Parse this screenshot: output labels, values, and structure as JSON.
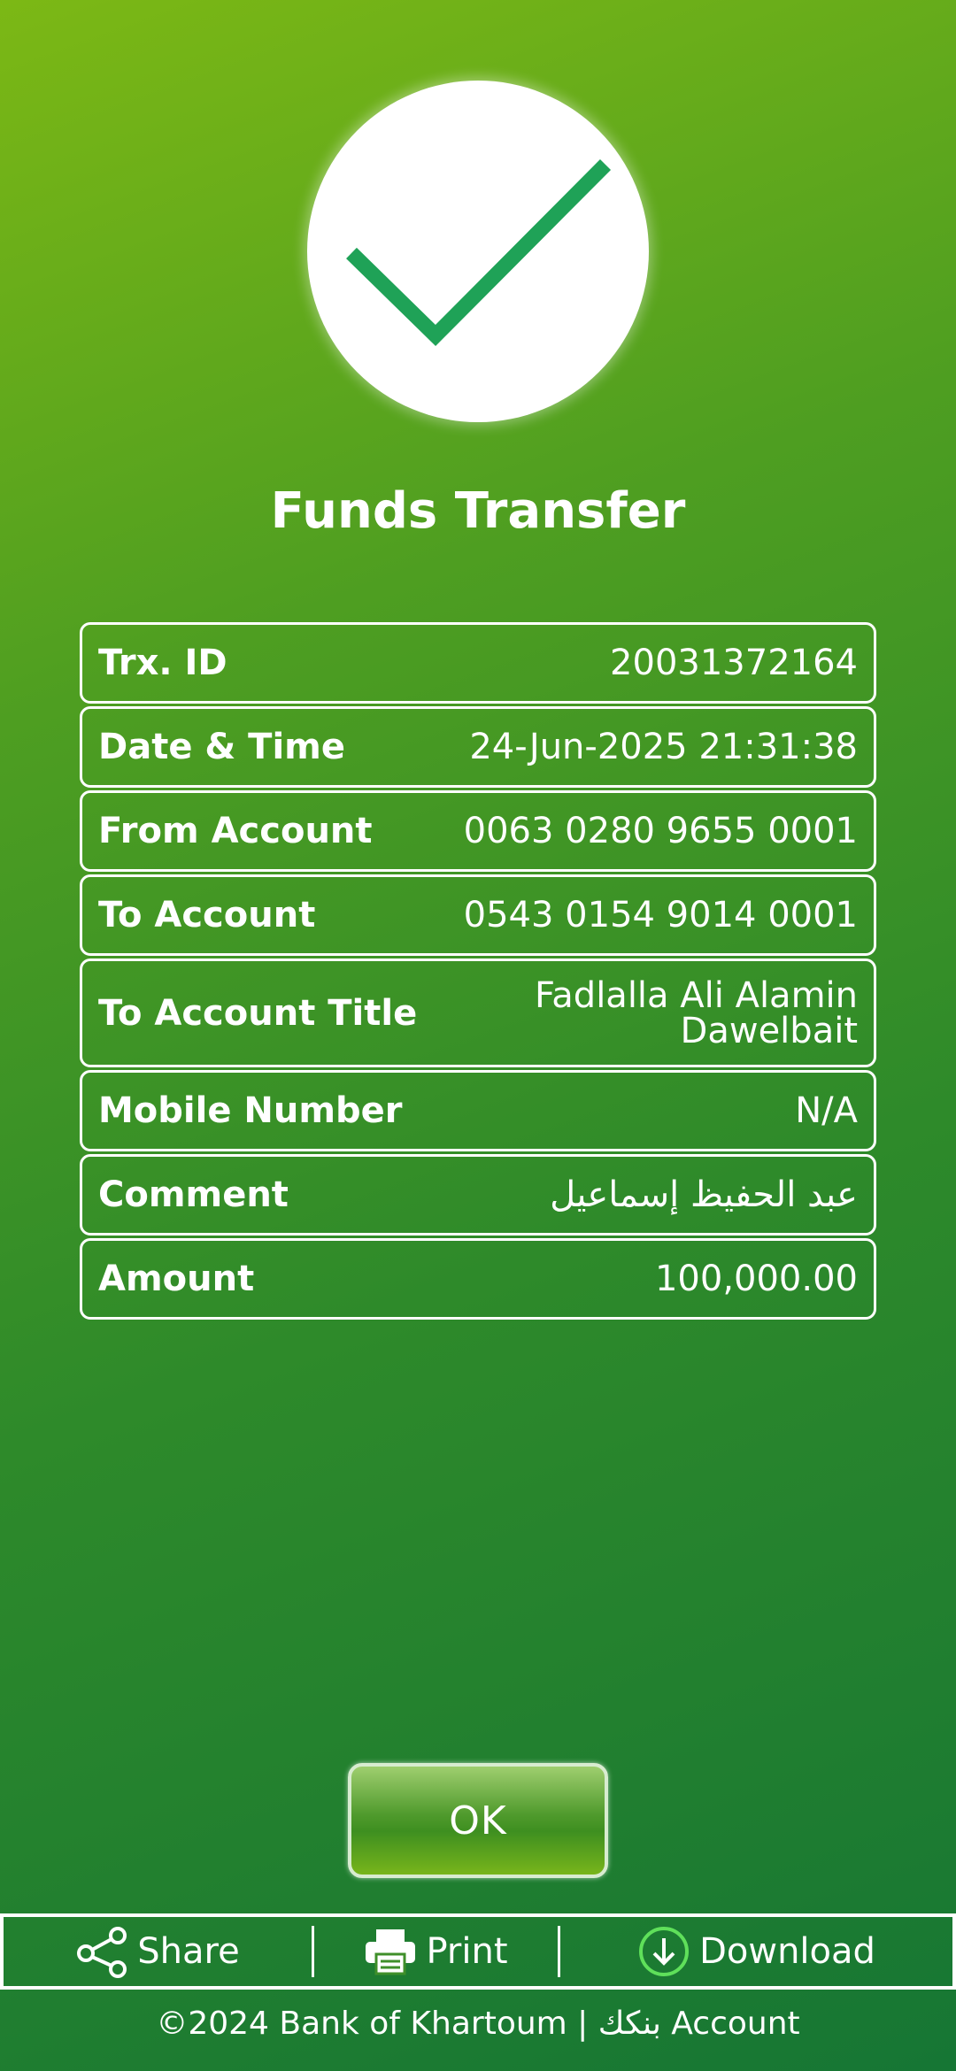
{
  "header": {
    "title": "Funds Transfer"
  },
  "details": [
    {
      "label": "Trx. ID",
      "value": "20031372164"
    },
    {
      "label": "Date & Time",
      "value": "24-Jun-2025 21:31:38"
    },
    {
      "label": "From Account",
      "value": "0063 0280 9655 0001"
    },
    {
      "label": "To Account",
      "value": "0543 0154 9014 0001"
    },
    {
      "label": "To Account Title",
      "value_line1": "Fadlalla Ali Alamin",
      "value_line2": "Dawelbait"
    },
    {
      "label": "Mobile Number",
      "value": "N/A"
    },
    {
      "label": "Comment",
      "value": "عبد الحفيظ إسماعيل"
    },
    {
      "label": "Amount",
      "value": "100,000.00"
    }
  ],
  "ok_button": {
    "label": "OK"
  },
  "actions": {
    "share": "Share",
    "print": "Print",
    "download": "Download"
  },
  "footer": {
    "text": "©2024 Bank of Khartoum | بنكك Account"
  },
  "icons": {
    "success": "checkmark-icon",
    "share": "share-icon",
    "print": "printer-icon",
    "download": "download-icon"
  },
  "colors": {
    "check": "#1fa257",
    "background_top": "#7cb815",
    "background_bottom": "#167634"
  }
}
